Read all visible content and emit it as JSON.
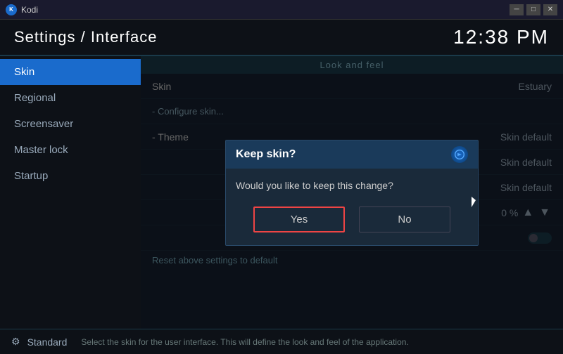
{
  "titlebar": {
    "app_name": "Kodi",
    "minimize_label": "─",
    "maximize_label": "□",
    "close_label": "✕"
  },
  "header": {
    "title": "Settings / Interface",
    "time": "12:38 PM"
  },
  "sidebar": {
    "items": [
      {
        "id": "skin",
        "label": "Skin",
        "active": true
      },
      {
        "id": "regional",
        "label": "Regional",
        "active": false
      },
      {
        "id": "screensaver",
        "label": "Screensaver",
        "active": false
      },
      {
        "id": "masterlock",
        "label": "Master lock",
        "active": false
      },
      {
        "id": "startup",
        "label": "Startup",
        "active": false
      }
    ]
  },
  "content": {
    "section_header": "Look and feel",
    "settings": [
      {
        "label": "Skin",
        "value": "Estuary",
        "type": "value"
      },
      {
        "label": "- Configure skin...",
        "value": "",
        "type": "link"
      },
      {
        "label": "- Theme",
        "value": "Skin default",
        "type": "value"
      },
      {
        "label": "",
        "value": "Skin default",
        "type": "value"
      },
      {
        "label": "",
        "value": "Skin default",
        "type": "value"
      },
      {
        "label": "",
        "value": "0 %",
        "type": "value-arrows"
      },
      {
        "label": "",
        "value": "",
        "type": "toggle"
      }
    ],
    "reset_link": "Reset above settings to default"
  },
  "dialog": {
    "title": "Keep skin?",
    "message": "Would you like to keep this change?",
    "kodi_icon": "✦",
    "yes_label": "Yes",
    "no_label": "No"
  },
  "footer": {
    "icon": "⚙",
    "label": "Standard",
    "description": "Select the skin for the user interface. This will define the look and feel of the application."
  }
}
